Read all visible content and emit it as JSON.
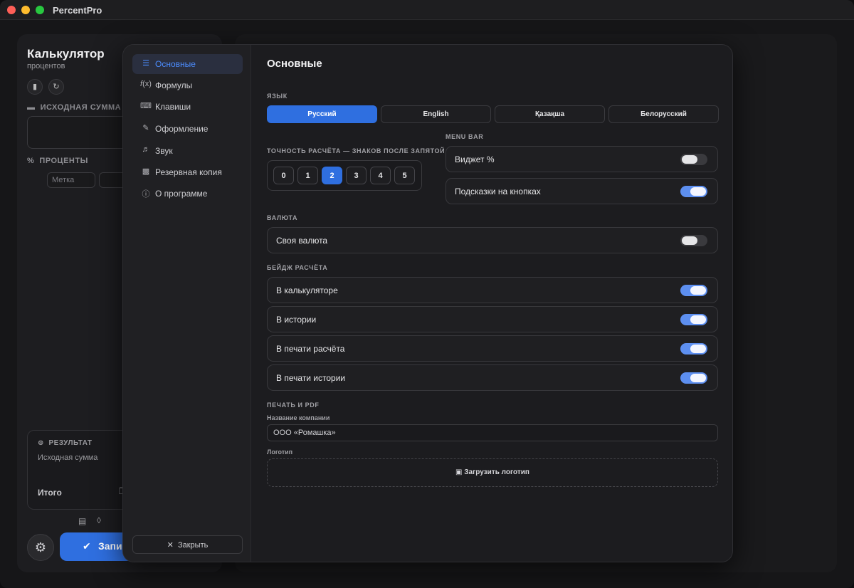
{
  "app": {
    "title": "PercentPro"
  },
  "calculator": {
    "title": "Калькулятор",
    "subtitle": "процентов",
    "source_label": "ИСХОДНАЯ СУММА",
    "percent_label": "ПРОЦЕНТЫ",
    "tag_placeholder": "Метка",
    "result_title": "РЕЗУЛЬТАТ",
    "result_source": "Исходная сумма",
    "result_total": "Итого",
    "save_label": "Запи"
  },
  "settings": {
    "heading": "Основные",
    "sidebar": [
      {
        "label": "Основные",
        "icon": "sliders-icon"
      },
      {
        "label": "Формулы",
        "icon": "function-icon"
      },
      {
        "label": "Клавиши",
        "icon": "keyboard-icon"
      },
      {
        "label": "Оформление",
        "icon": "brush-icon"
      },
      {
        "label": "Звук",
        "icon": "speaker-icon"
      },
      {
        "label": "Резервная копия",
        "icon": "drive-icon"
      },
      {
        "label": "О программе",
        "icon": "info-icon"
      }
    ],
    "close_label": "Закрыть",
    "language": {
      "label": "ЯЗЫК",
      "options": [
        "Русский",
        "English",
        "Қазақша",
        "Белорусский"
      ],
      "selected": "Русский"
    },
    "precision": {
      "label": "ТОЧНОСТЬ РАСЧЁТА — ЗНАКОВ ПОСЛЕ ЗАПЯТОЙ",
      "options": [
        "0",
        "1",
        "2",
        "3",
        "4",
        "5"
      ],
      "selected": "2"
    },
    "menu_bar": {
      "label": "MENU BAR",
      "widget": {
        "label": "Виджет %",
        "on": false
      },
      "hints": {
        "label": "Подсказки на кнопках",
        "on": true
      }
    },
    "currency": {
      "label": "ВАЛЮТА",
      "custom": {
        "label": "Своя валюта",
        "on": false
      }
    },
    "badge": {
      "label": "БЕЙДЖ РАСЧЁТА",
      "items": [
        {
          "label": "В калькуляторе",
          "on": true
        },
        {
          "label": "В истории",
          "on": true
        },
        {
          "label": "В печати расчёта",
          "on": true
        },
        {
          "label": "В печати истории",
          "on": true
        }
      ]
    },
    "print": {
      "label": "ПЕЧАТЬ И PDF",
      "company_label": "Название компании",
      "company_value": "ООО «Ромашка»",
      "logo_label": "Логотип",
      "upload_label": "Загрузить логотип"
    }
  },
  "colors": {
    "accent": "#2f6fe0",
    "toggle_on": "#5d8ff0",
    "active_nav_text": "#4c8dff"
  }
}
